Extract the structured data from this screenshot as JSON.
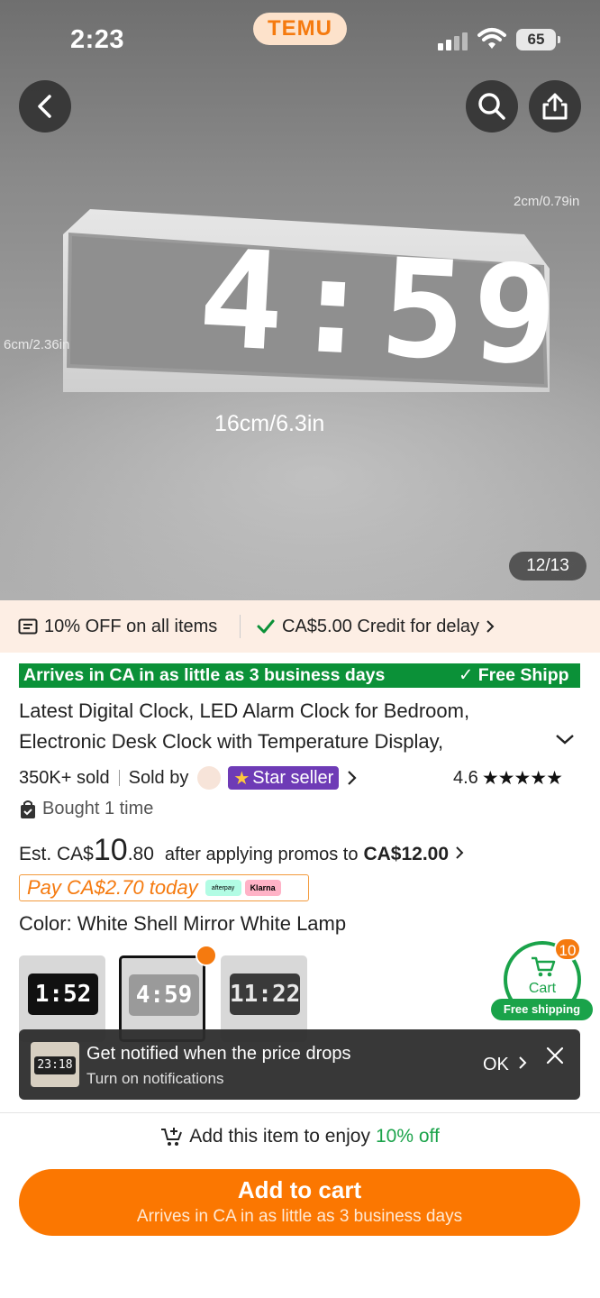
{
  "status_bar": {
    "time": "2:23",
    "brand": "TEMU",
    "battery": "65"
  },
  "gallery": {
    "dimension_height": "6cm/2.36in",
    "dimension_depth": "2cm/0.79in",
    "dimension_width": "16cm/6.3in",
    "clock_display": "4:59",
    "counter": "12/13"
  },
  "promo_bar": {
    "discount": "10% OFF on all items",
    "credit": "CA$5.00 Credit for delay"
  },
  "banner": {
    "arrives": "Arrives in CA in as little as 3 business days",
    "free_shipping": "✓ Free Shipp"
  },
  "product": {
    "title": "Latest Digital Clock, LED Alarm Clock for Bedroom, Electronic Desk Clock with Temperature Display,",
    "sold": "350K+ sold",
    "sold_by": "Sold by",
    "star_seller": "Star seller",
    "rating": "4.6",
    "bought": "Bought 1 time"
  },
  "price": {
    "est_prefix": "Est. CA$",
    "whole": "10",
    "cents": ".80",
    "after": "after applying promos to",
    "final": "CA$12.00",
    "pay_today": "Pay CA$2.70 today",
    "afterpay": "afterpay",
    "klarna": "Klarna"
  },
  "color": {
    "label": "Color: White Shell Mirror White Lamp",
    "options": [
      {
        "digits": "1:52",
        "selected": false
      },
      {
        "digits": "4:59",
        "selected": true
      },
      {
        "digits": "11:22",
        "selected": false
      }
    ]
  },
  "cart": {
    "label": "Cart",
    "count": "10",
    "free_shipping": "Free shipping"
  },
  "toast": {
    "thumb_time": "23:18",
    "title": "Get notified when the price drops",
    "subtitle": "Turn on notifications",
    "ok": "OK"
  },
  "bottom": {
    "enjoy_prefix": "Add this item to enjoy",
    "enjoy_value": "10% off",
    "add_to_cart": "Add to cart",
    "add_sub": "Arrives in CA in as little as 3 business days"
  },
  "colors": {
    "accent": "#fb7701",
    "green": "#0b9138",
    "star_seller": "#6e3bb6"
  }
}
